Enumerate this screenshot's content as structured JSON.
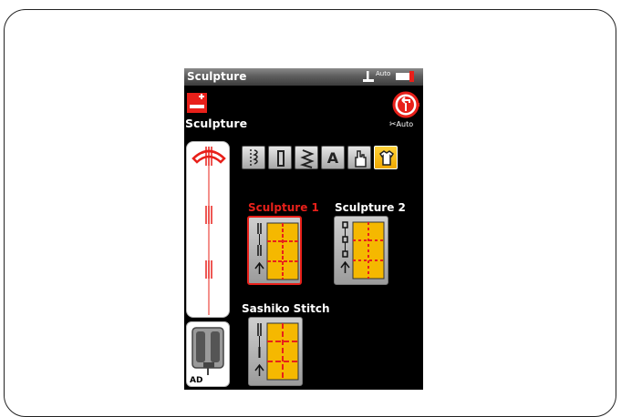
{
  "titlebar": {
    "title": "Sculpture",
    "auto_label": "Auto",
    "icons": [
      "presser-foot-icon",
      "needle-position-icon"
    ]
  },
  "mode": {
    "label": "Sculpture",
    "icon": "sculpture-mode-icon"
  },
  "reset": {
    "icon": "reset-icon",
    "auto_label": "Auto"
  },
  "foot": {
    "label": "AD"
  },
  "categories": [
    {
      "icon": "utility-stitch-icon",
      "selected": false
    },
    {
      "icon": "buttonhole-icon",
      "selected": false
    },
    {
      "icon": "decorative-stitch-icon",
      "selected": false
    },
    {
      "glyph": "A",
      "icon": "alphabet-icon",
      "selected": false
    },
    {
      "icon": "hand-icon",
      "selected": false
    },
    {
      "icon": "sculpture-shirt-icon",
      "selected": true
    }
  ],
  "stitches": [
    {
      "label": "Sculpture 1",
      "selected": true,
      "label_color": "#e8201a"
    },
    {
      "label": "Sculpture 2",
      "selected": false,
      "label_color": "#ffffff"
    },
    {
      "label": "Sashiko Stitch",
      "selected": false,
      "label_color": "#ffffff"
    }
  ],
  "colors": {
    "accent_red": "#e8201a",
    "selected_yellow": "#f5b800",
    "pattern_orange": "#f0a020"
  }
}
